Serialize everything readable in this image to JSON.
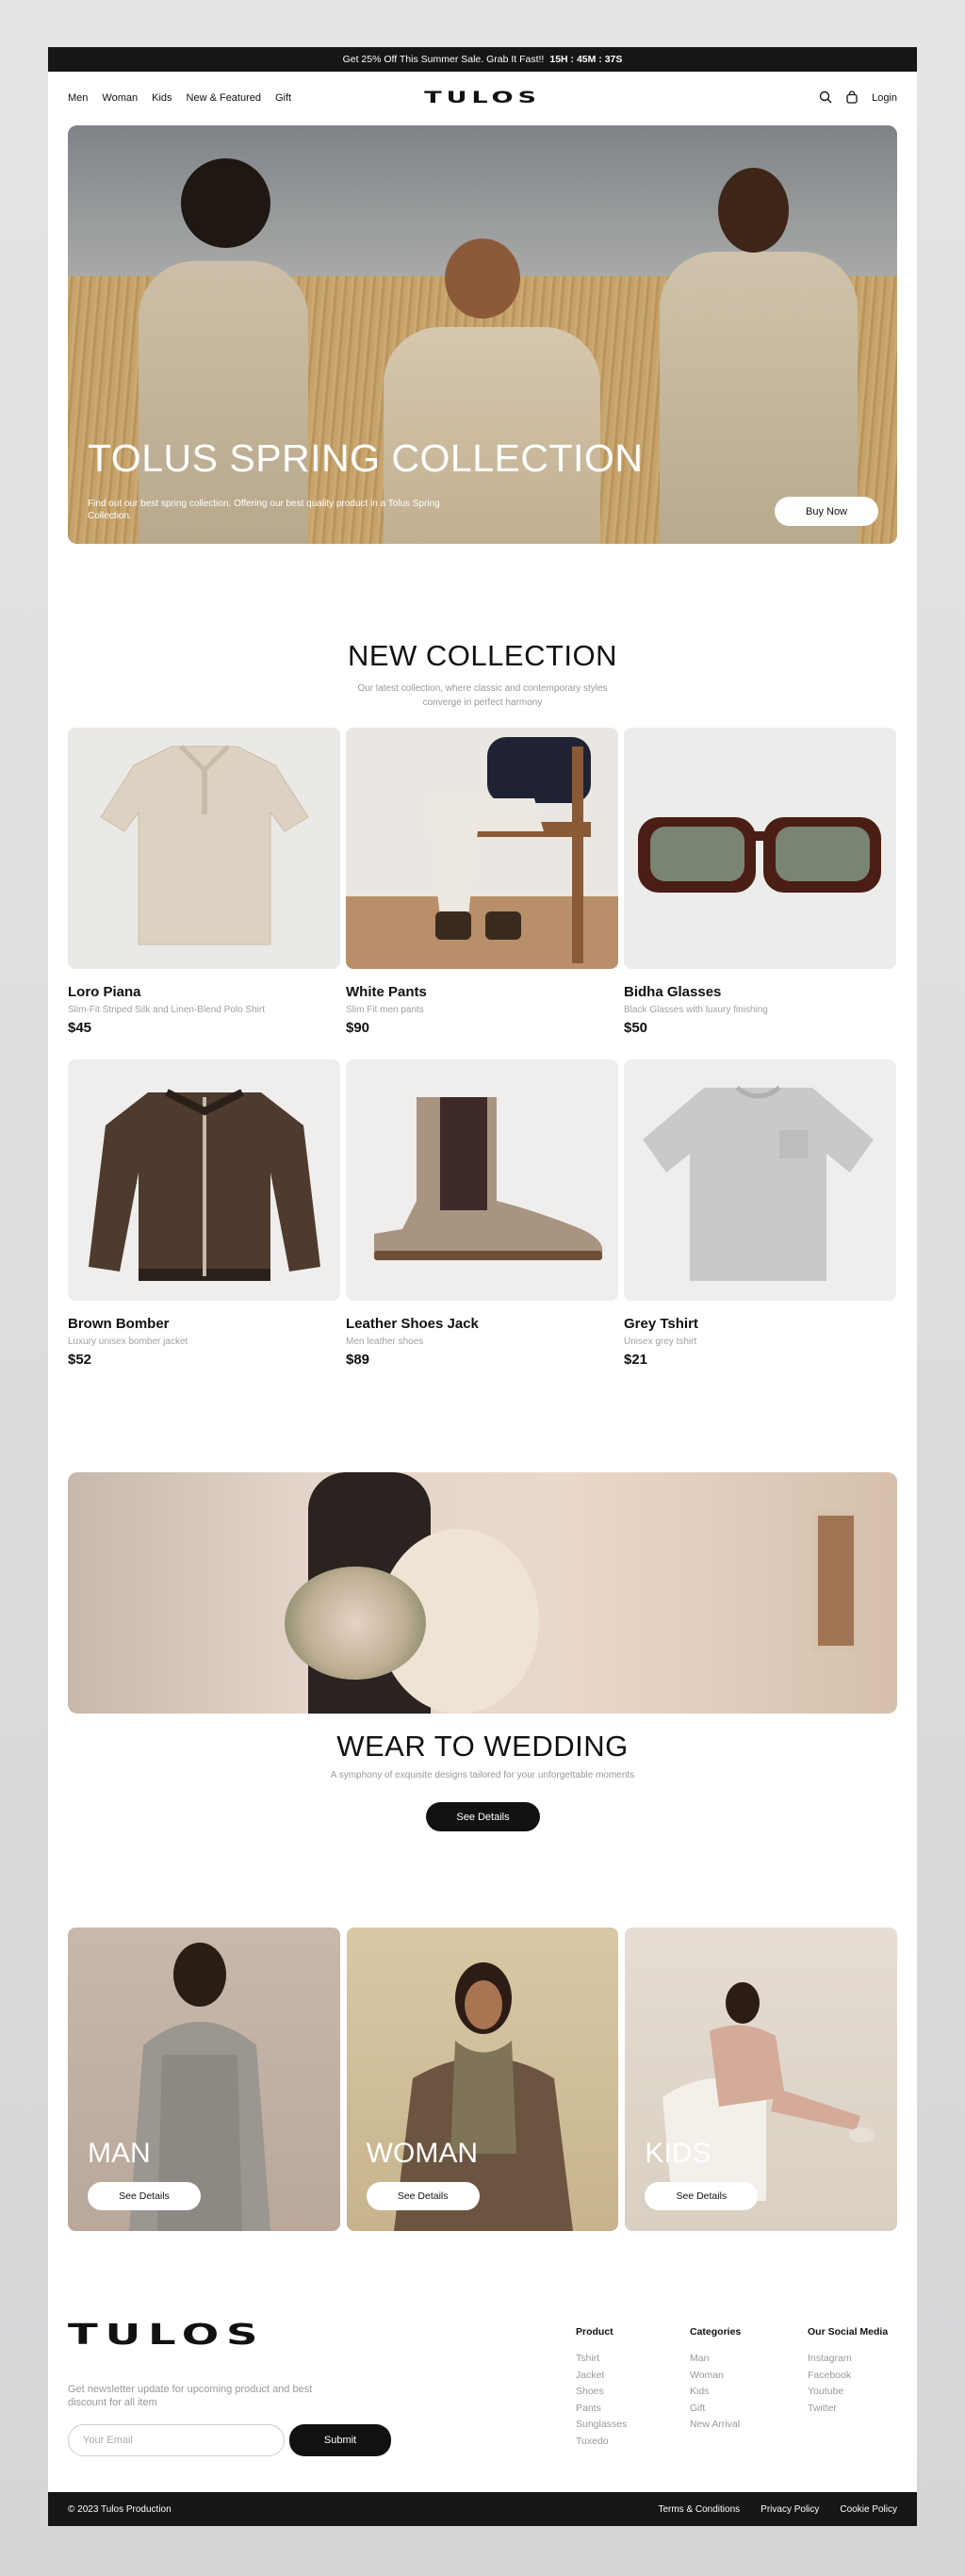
{
  "topbar": {
    "promo": "Get 25% Off This Summer Sale. Grab It Fast!!",
    "countdown": "15H : 45M : 37S"
  },
  "nav": {
    "links": [
      "Men",
      "Woman",
      "Kids",
      "New & Featured",
      "Gift"
    ],
    "logo": "TULOS",
    "login": "Login",
    "icons": [
      "search-icon",
      "bag-icon"
    ]
  },
  "hero": {
    "title": "TOLUS SPRING COLLECTION",
    "text": "Find out our best spring collection. Offering our best quality product in a Tolus Spring Collection.",
    "button": "Buy Now"
  },
  "new_collection": {
    "title": "NEW COLLECTION",
    "subtitle": "Our latest collection, where classic and contemporary styles converge in perfect harmony",
    "products": [
      {
        "name": "Loro Piana",
        "desc": "Slim-Fit Striped Silk and Linen-Blend Polo Shirt",
        "price": "$45"
      },
      {
        "name": "White Pants",
        "desc": "Slim Fit men pants",
        "price": "$90"
      },
      {
        "name": "Bidha Glasses",
        "desc": "Black Glasses with luxury finishing",
        "price": "$50"
      },
      {
        "name": "Brown Bomber",
        "desc": "Luxury unisex bomber jacket",
        "price": "$52"
      },
      {
        "name": "Leather Shoes Jack",
        "desc": "Men leather shoes",
        "price": "$89"
      },
      {
        "name": "Grey Tshirt",
        "desc": "Unisex grey tshirt",
        "price": "$21"
      }
    ]
  },
  "wedding": {
    "title": "WEAR TO WEDDING",
    "subtitle": "A symphony of exquisite designs tailored for your unforgettable moments",
    "button": "See Details"
  },
  "categories": [
    {
      "label": "MAN",
      "button": "See Details"
    },
    {
      "label": "WOMAN",
      "button": "See Details"
    },
    {
      "label": "KIDS",
      "button": "See Details"
    }
  ],
  "footer": {
    "logo": "TULOS",
    "newsletter": "Get newsletter update for upcoming product and best discount for all item",
    "email_placeholder": "Your Email",
    "submit": "Submit",
    "columns": [
      {
        "title": "Product",
        "items": [
          "Tshirt",
          "Jacket",
          "Shoes",
          "Pants",
          "Sunglasses",
          "Tuxedo"
        ]
      },
      {
        "title": "Categories",
        "items": [
          "Man",
          "Woman",
          "Kids",
          "Gift",
          "New Arrival"
        ]
      },
      {
        "title": "Our Social Media",
        "items": [
          "Instagram",
          "Facebook",
          "Youtube",
          "Twitter"
        ]
      }
    ],
    "copyright": "© 2023 Tulos Production",
    "legal": [
      "Terms & Conditions",
      "Privacy Policy",
      "Cookie Policy"
    ]
  }
}
